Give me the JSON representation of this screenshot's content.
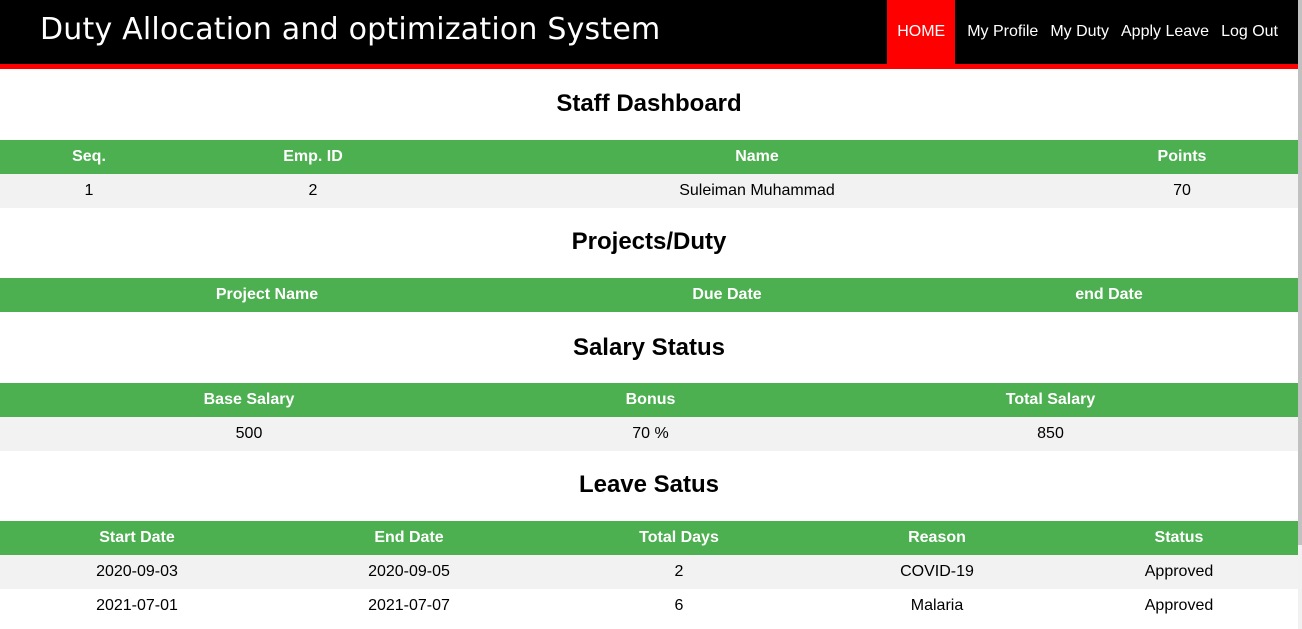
{
  "header": {
    "title": "Duty Allocation and optimization System",
    "nav": [
      "HOME",
      "My Profile",
      "My Duty",
      "Apply Leave",
      "Log Out"
    ]
  },
  "dashboard": {
    "title": "Staff Dashboard",
    "columns": [
      "Seq.",
      "Emp. ID",
      "Name",
      "Points"
    ],
    "rows": [
      [
        "1",
        "2",
        "Suleiman Muhammad",
        "70"
      ]
    ]
  },
  "projects": {
    "title": "Projects/Duty",
    "columns": [
      "Project Name",
      "Due Date",
      "end Date"
    ]
  },
  "salary": {
    "title": "Salary Status",
    "columns": [
      "Base Salary",
      "Bonus",
      "Total Salary"
    ],
    "rows": [
      [
        "500",
        "70 %",
        "850"
      ]
    ]
  },
  "leave": {
    "title": "Leave Satus",
    "columns": [
      "Start Date",
      "End Date",
      "Total Days",
      "Reason",
      "Status"
    ],
    "rows": [
      [
        "2020-09-03",
        "2020-09-05",
        "2",
        "COVID-19",
        "Approved"
      ],
      [
        "2021-07-01",
        "2021-07-07",
        "6",
        "Malaria",
        "Approved"
      ]
    ]
  },
  "colors": {
    "header_bg": "#000000",
    "accent_red": "#ff0000",
    "table_header_green": "#4caf50",
    "row_stripe": "#f2f2f2"
  }
}
